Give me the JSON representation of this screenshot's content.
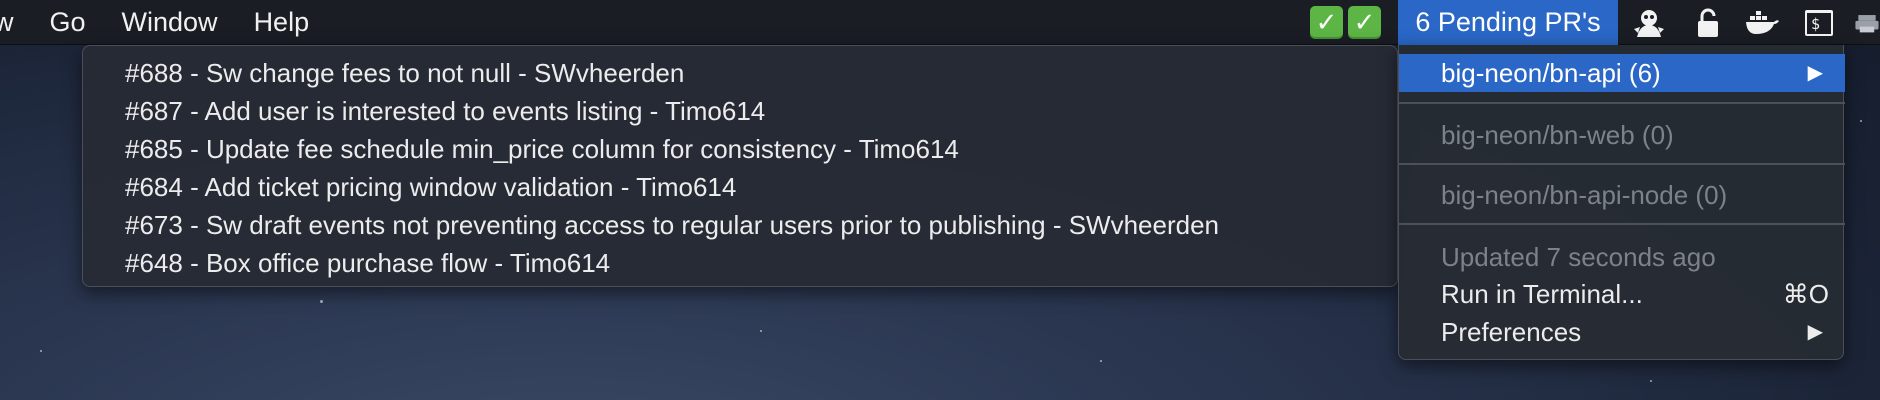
{
  "menubar": {
    "items": [
      {
        "label": "w"
      },
      {
        "label": "Go"
      },
      {
        "label": "Window"
      },
      {
        "label": "Help"
      }
    ],
    "tray": {
      "status_icons": [
        "check-icon",
        "check-icon"
      ],
      "pending_label": "6 Pending PR's",
      "icons": [
        "mascot-icon",
        "lock-icon",
        "docker-icon",
        "terminal-icon"
      ]
    }
  },
  "submenu": {
    "items": [
      {
        "label": "#688 - Sw change fees to not null - SWvheerden"
      },
      {
        "label": "#687 - Add user is interested to events listing - Timo614"
      },
      {
        "label": "#685 - Update fee schedule min_price column for consistency - Timo614"
      },
      {
        "label": "#684 - Add ticket pricing window validation - Timo614"
      },
      {
        "label": "#673 - Sw draft events not preventing access to regular users prior to publishing - SWvheerden"
      },
      {
        "label": "#648 - Box office purchase flow - Timo614"
      }
    ]
  },
  "dropdown": {
    "repos": [
      {
        "label": "big-neon/bn-api (6)",
        "arrow": "▶"
      },
      {
        "label": "big-neon/bn-web (0)"
      },
      {
        "label": "big-neon/bn-api-node (0)"
      }
    ],
    "updated_label": "Updated 7 seconds ago",
    "run_in_terminal": {
      "label": "Run in Terminal...",
      "shortcut": "⌘O"
    },
    "preferences": {
      "label": "Preferences",
      "arrow": "▶"
    }
  },
  "colors": {
    "accent": "#2a67c7",
    "check_green": "#5cb544",
    "menubar": "#1a1d24"
  }
}
